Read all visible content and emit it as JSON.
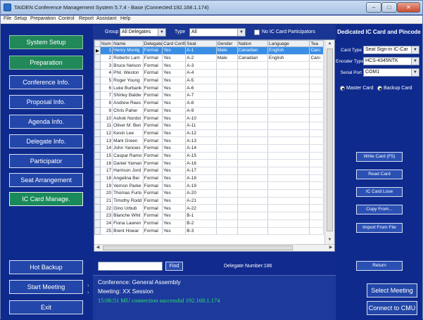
{
  "window": {
    "title": "TAIDEN Conference Management System 5.7.4 - Base (Connected:192.168.1.174)",
    "buttons": [
      "–",
      "□",
      "✕"
    ]
  },
  "menu": [
    "File",
    "Setup",
    "Preparation",
    "Control",
    "Report",
    "Assistant",
    "Help"
  ],
  "nav": {
    "system_setup": "System Setup",
    "preparation": "Preparation",
    "conference_info": "Conference Info.",
    "proposal_info": "Proposal Info.",
    "agenda_info": "Agenda Info.",
    "delegate_info": "Delegate Info.",
    "participator": "Participator",
    "seat_arrangement": "Seat Arrangement",
    "ic_card_manage": "IC Card Manage.",
    "hot_backup": "Hot Backup",
    "start_meeting": "Start Meeting",
    "exit": "Exit"
  },
  "filters": {
    "group_label": "Group",
    "group_value": "All Delegates",
    "type_label": "Type",
    "type_value": "All",
    "no_card_label": "No IC Card Participators"
  },
  "table": {
    "columns": [
      "Num",
      "Name",
      "Delegate",
      "Card Config",
      "Seat",
      "Gender",
      "Nation",
      "Language",
      "Tea"
    ],
    "rows": [
      [
        "1",
        "Henry Montg",
        "Formal",
        "Yes",
        "A-1",
        "Male",
        "Canadian",
        "English",
        "Canı"
      ],
      [
        "2",
        "Roberto Lam",
        "Formal",
        "Yes",
        "A-2",
        "Male",
        "Canadian",
        "English",
        "Canı"
      ],
      [
        "3",
        "Bruce Nelson",
        "Formal",
        "Yes",
        "A-3",
        "",
        "",
        "",
        ""
      ],
      [
        "4",
        "Phil. Weston",
        "Formal",
        "Yes",
        "A-4",
        "",
        "",
        "",
        ""
      ],
      [
        "5",
        "Roger Young",
        "Formal",
        "Yes",
        "A-5",
        "",
        "",
        "",
        ""
      ],
      [
        "6",
        "Luke Burbank",
        "Formal",
        "Yes",
        "A-6",
        "",
        "",
        "",
        ""
      ],
      [
        "7",
        "Shirley Baldw",
        "Formal",
        "Yes",
        "A-7",
        "",
        "",
        "",
        ""
      ],
      [
        "8",
        "Andrew Rees",
        "Formal",
        "Yes",
        "A-8",
        "",
        "",
        "",
        ""
      ],
      [
        "9",
        "Chris Paher",
        "Formal",
        "Yes",
        "A-9",
        "",
        "",
        "",
        ""
      ],
      [
        "10",
        "Ashok Nordst",
        "Formal",
        "Yes",
        "A-10",
        "",
        "",
        "",
        ""
      ],
      [
        "11",
        "Oliver M. Ben",
        "Formal",
        "Yes",
        "A-11",
        "",
        "",
        "",
        ""
      ],
      [
        "12",
        "Kevin Lee",
        "Formal",
        "Yes",
        "A-12",
        "",
        "",
        "",
        ""
      ],
      [
        "13",
        "Mark Green",
        "Formal",
        "Yes",
        "A-13",
        "",
        "",
        "",
        ""
      ],
      [
        "14",
        "John Yanows",
        "Formal",
        "Yes",
        "A-14",
        "",
        "",
        "",
        ""
      ],
      [
        "15",
        "Caspar Ramo",
        "Formal",
        "Yes",
        "A-15",
        "",
        "",
        "",
        ""
      ],
      [
        "16",
        "Daniel Yaman",
        "Formal",
        "Yes",
        "A-16",
        "",
        "",
        "",
        ""
      ],
      [
        "17",
        "Harrison Jord",
        "Formal",
        "Yes",
        "A-17",
        "",
        "",
        "",
        ""
      ],
      [
        "18",
        "Angelina Ber",
        "Formal",
        "Yes",
        "A-18",
        "",
        "",
        "",
        ""
      ],
      [
        "19",
        "Vernon Parke",
        "Formal",
        "Yes",
        "A-19",
        "",
        "",
        "",
        ""
      ],
      [
        "20",
        "Thomas Furlo",
        "Formal",
        "Yes",
        "A-20",
        "",
        "",
        "",
        ""
      ],
      [
        "21",
        "Timothy Rodd",
        "Formal",
        "Yes",
        "A-21",
        "",
        "",
        "",
        ""
      ],
      [
        "22",
        "Gino Urbub",
        "Formal",
        "Yes",
        "A-22",
        "",
        "",
        "",
        ""
      ],
      [
        "23",
        "Blanche Whit",
        "Formal",
        "Yes",
        "B-1",
        "",
        "",
        "",
        ""
      ],
      [
        "24",
        "Fiona Lawren",
        "Formal",
        "Yes",
        "B-2",
        "",
        "",
        "",
        ""
      ],
      [
        "25",
        "Brent Howar",
        "Formal",
        "Yes",
        "B-3",
        "",
        "",
        "",
        ""
      ]
    ],
    "selected_row": 0
  },
  "find": {
    "input_value": "",
    "button_label": "Find",
    "delegate_count": "Delegate Number:186"
  },
  "status": {
    "conference": "Conference: General Assembly",
    "meeting": "Meeting: XX Session",
    "message": "15:06:51 MU connection successful 192.168.1.174"
  },
  "card_panel": {
    "title": "Dedicated IC Card and Pincode",
    "card_type_label": "Card Type",
    "card_type_value": "Seat Sign-in IC-Car",
    "encoder_type_label": "Encoder Type",
    "encoder_type_value": "HCS-4345NTK",
    "serial_port_label": "Serial Port",
    "serial_port_value": "COM1",
    "master_card_label": "Master Card",
    "backup_card_label": "Backup Card",
    "write_card": "Write Card (F5)",
    "read_card": "Read Card",
    "ic_card_lose": "IC Card Lose",
    "copy_from": "Copy From...",
    "import_from_file": "Import From File",
    "return": "Return",
    "select_meeting": "Select Meeting",
    "connect_to_cmu": "Connect to CMU"
  },
  "colors": {
    "background": "#0f2a8d",
    "button": "#2246a9",
    "active_button": "#1a8a5a",
    "selected_row": "#3a8ee6",
    "status_message": "#2ee66a"
  }
}
